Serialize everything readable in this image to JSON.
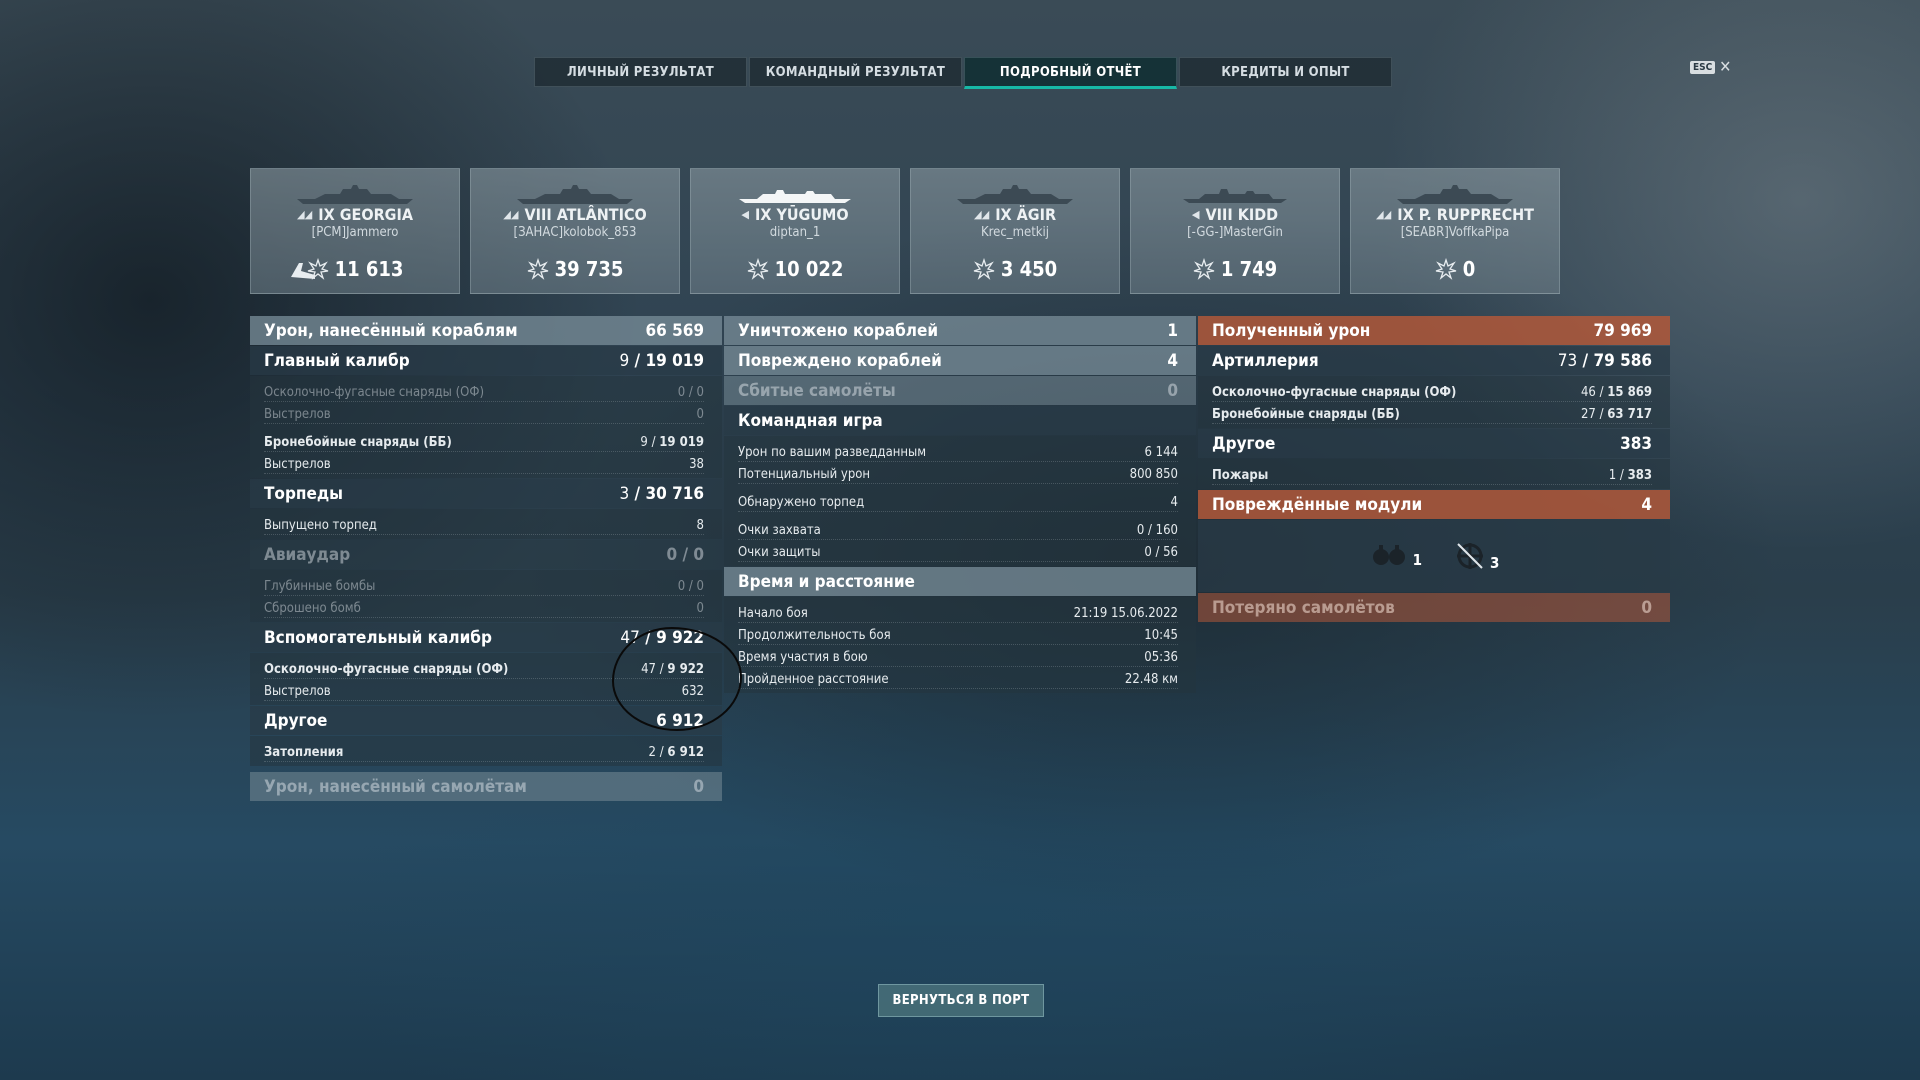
{
  "tabs": [
    {
      "label": "ЛИЧНЫЙ РЕЗУЛЬТАТ",
      "active": false
    },
    {
      "label": "КОМАНДНЫЙ РЕЗУЛЬТАТ",
      "active": false
    },
    {
      "label": "ПОДРОБНЫЙ ОТЧЁТ",
      "active": true
    },
    {
      "label": "КРЕДИТЫ И ОПЫТ",
      "active": false
    }
  ],
  "esc": {
    "key": "ESC",
    "close": "✕"
  },
  "ships": [
    {
      "name": "IX GEORGIA",
      "player": "[PCM]Jammero",
      "damage": "11 613",
      "icon": "battleship-icon"
    },
    {
      "name": "VIII ATLÂNTICO",
      "player": "[ЗАНАС]kolobok_853",
      "damage": "39 735",
      "icon": "battleship-icon"
    },
    {
      "name": "IX YŪGUMO",
      "player": "diptan_1",
      "damage": "10 022",
      "icon": "destroyer-icon"
    },
    {
      "name": "IX ÄGIR",
      "player": "Krec_metkij",
      "damage": "3 450",
      "icon": "battleship-icon"
    },
    {
      "name": "VIII KIDD",
      "player": "[-GG-]MasterGin",
      "damage": "1 749",
      "icon": "destroyer-icon"
    },
    {
      "name": "IX P. RUPPRECHT",
      "player": "[SEABR]VoffkaPipa",
      "damage": "0",
      "icon": "battleship-icon"
    }
  ],
  "col1": {
    "dmg_ships": {
      "label": "Урон, нанесённый кораблям",
      "value": "66 569"
    },
    "main_battery": {
      "label": "Главный калибр",
      "a": "9",
      "b": "19 019"
    },
    "mb_he": {
      "label": "Осколочно-фугасные снаряды (ОФ)",
      "value": "0 / 0"
    },
    "mb_he_shots": {
      "label": "Выстрелов",
      "value": "0"
    },
    "mb_ap": {
      "label": "Бронебойные снаряды (ББ)",
      "a": "9",
      "b": "19 019"
    },
    "mb_ap_shots": {
      "label": "Выстрелов",
      "value": "38"
    },
    "torpedoes": {
      "label": "Торпеды",
      "a": "3",
      "b": "30 716"
    },
    "torp_launched": {
      "label": "Выпущено торпед",
      "value": "8"
    },
    "air_strike": {
      "label": "Авиаудар",
      "value": "0 / 0"
    },
    "depth_charges": {
      "label": "Глубинные бомбы",
      "value": "0 / 0"
    },
    "bombs_dropped": {
      "label": "Сброшено бомб",
      "value": "0"
    },
    "secondary": {
      "label": "Вспомогательный калибр",
      "a": "47",
      "b": "9 922"
    },
    "sec_he": {
      "label": "Осколочно-фугасные снаряды (ОФ)",
      "a": "47",
      "b": "9 922"
    },
    "sec_shots": {
      "label": "Выстрелов",
      "value": "632"
    },
    "other": {
      "label": "Другое",
      "value": "6 912"
    },
    "flooding": {
      "label": "Затопления",
      "a": "2",
      "b": "6 912"
    },
    "dmg_planes": {
      "label": "Урон, нанесённый самолётам",
      "value": "0"
    }
  },
  "col2": {
    "destroyed": {
      "label": "Уничтожено кораблей",
      "value": "1"
    },
    "damaged": {
      "label": "Повреждено кораблей",
      "value": "4"
    },
    "planes_shot": {
      "label": "Сбитые самолёты",
      "value": "0"
    },
    "teamplay": {
      "label": "Командная игра"
    },
    "spot_dmg": {
      "label": "Урон по вашим разведданным",
      "value": "6 144"
    },
    "potential": {
      "label": "Потенциальный урон",
      "value": "800 850"
    },
    "torp_spotted": {
      "label": "Обнаружено торпед",
      "value": "4"
    },
    "capture": {
      "label": "Очки захвата",
      "value": "0 / 160"
    },
    "defense": {
      "label": "Очки защиты",
      "value": "0 / 56"
    },
    "time_dist": {
      "label": "Время и расстояние"
    },
    "start": {
      "label": "Начало боя",
      "value": "21:19  15.06.2022"
    },
    "duration": {
      "label": "Продолжительность боя",
      "value": "10:45"
    },
    "participation": {
      "label": "Время участия в бою",
      "value": "05:36"
    },
    "distance": {
      "label": "Пройденное расстояние",
      "value": "22.48 км"
    }
  },
  "col3": {
    "received": {
      "label": "Полученный урон",
      "value": "79 969"
    },
    "artillery": {
      "label": "Артиллерия",
      "a": "73",
      "b": "79 586"
    },
    "art_he": {
      "label": "Осколочно-фугасные снаряды (ОФ)",
      "a": "46",
      "b": "15 869"
    },
    "art_ap": {
      "label": "Бронебойные снаряды (ББ)",
      "a": "27",
      "b": "63 717"
    },
    "other": {
      "label": "Другое",
      "value": "383"
    },
    "fires": {
      "label": "Пожары",
      "a": "1",
      "b": "383"
    },
    "modules": {
      "label": "Повреждённые модули",
      "value": "4"
    },
    "module_items": [
      {
        "icon": "engine-icon",
        "count": "1"
      },
      {
        "icon": "steering-gear-icon",
        "count": "3"
      }
    ],
    "planes_lost": {
      "label": "Потеряно самолётов",
      "value": "0"
    }
  },
  "port_button": "ВЕРНУТЬСЯ В ПОРТ",
  "colors": {
    "accent": "#17b8a6",
    "received_header": "#b0583a"
  }
}
